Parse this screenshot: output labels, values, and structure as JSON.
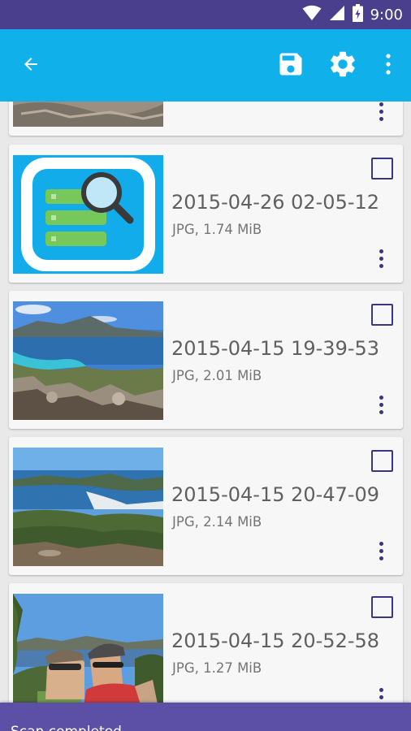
{
  "status_bar": {
    "time": "9:00",
    "icons": [
      "wifi-icon",
      "signal-icon",
      "battery-icon"
    ],
    "background": "#4a3f8c"
  },
  "app_bar": {
    "background": "#10b1eb",
    "icons": [
      "back-arrow-icon",
      "save-icon",
      "gear-icon",
      "overflow-menu-icon"
    ]
  },
  "files": [
    {
      "name": "",
      "details": "",
      "thumbnail": "landscape-photo",
      "checked": false
    },
    {
      "name": "2015-04-26 02-05-12",
      "details": "JPG, 1.74 MiB",
      "thumbnail": "app-logo",
      "checked": false
    },
    {
      "name": "2015-04-15 19-39-53",
      "details": "JPG, 2.01 MiB",
      "thumbnail": "bay-landscape-photo",
      "checked": false
    },
    {
      "name": "2015-04-15 20-47-09",
      "details": "JPG, 2.14 MiB",
      "thumbnail": "coast-landscape-photo",
      "checked": false
    },
    {
      "name": "2015-04-15 20-52-58",
      "details": "JPG, 1.27 MiB",
      "thumbnail": "selfie-photo",
      "checked": false
    }
  ],
  "snackbar": {
    "text": "Scan completed",
    "background": "#5b4fa6"
  },
  "colors": {
    "accent": "#3b3585",
    "title_text": "#606060",
    "meta_text": "#757575"
  }
}
